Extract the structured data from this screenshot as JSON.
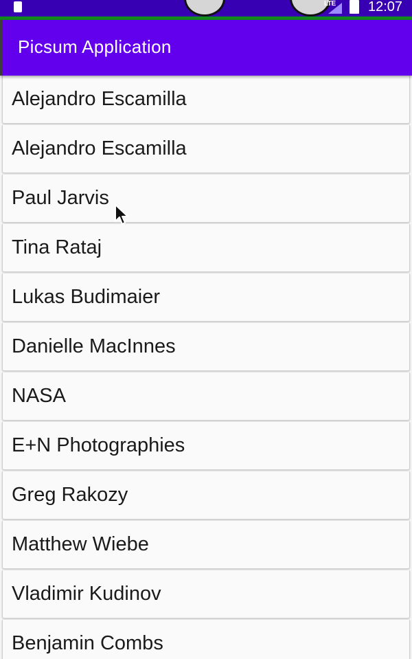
{
  "status_bar": {
    "network": "LTE",
    "time": "12:07",
    "icons": [
      "sim-card-icon",
      "signal-icon",
      "battery-icon"
    ]
  },
  "app_bar": {
    "title": "Picsum Application"
  },
  "authors": [
    "Alejandro Escamilla",
    "Alejandro Escamilla",
    "Paul Jarvis",
    "Tina Rataj",
    "Lukas Budimaier",
    "Danielle MacInnes",
    "NASA",
    "E+N Photographies",
    "Greg Rakozy",
    "Matthew Wiebe",
    "Vladimir Kudinov",
    "Benjamin Combs"
  ],
  "colors": {
    "status_bar": "#3700b3",
    "app_bar": "#6200ee",
    "list_item_background": "#fafafa",
    "text": "#1a1a1a"
  }
}
